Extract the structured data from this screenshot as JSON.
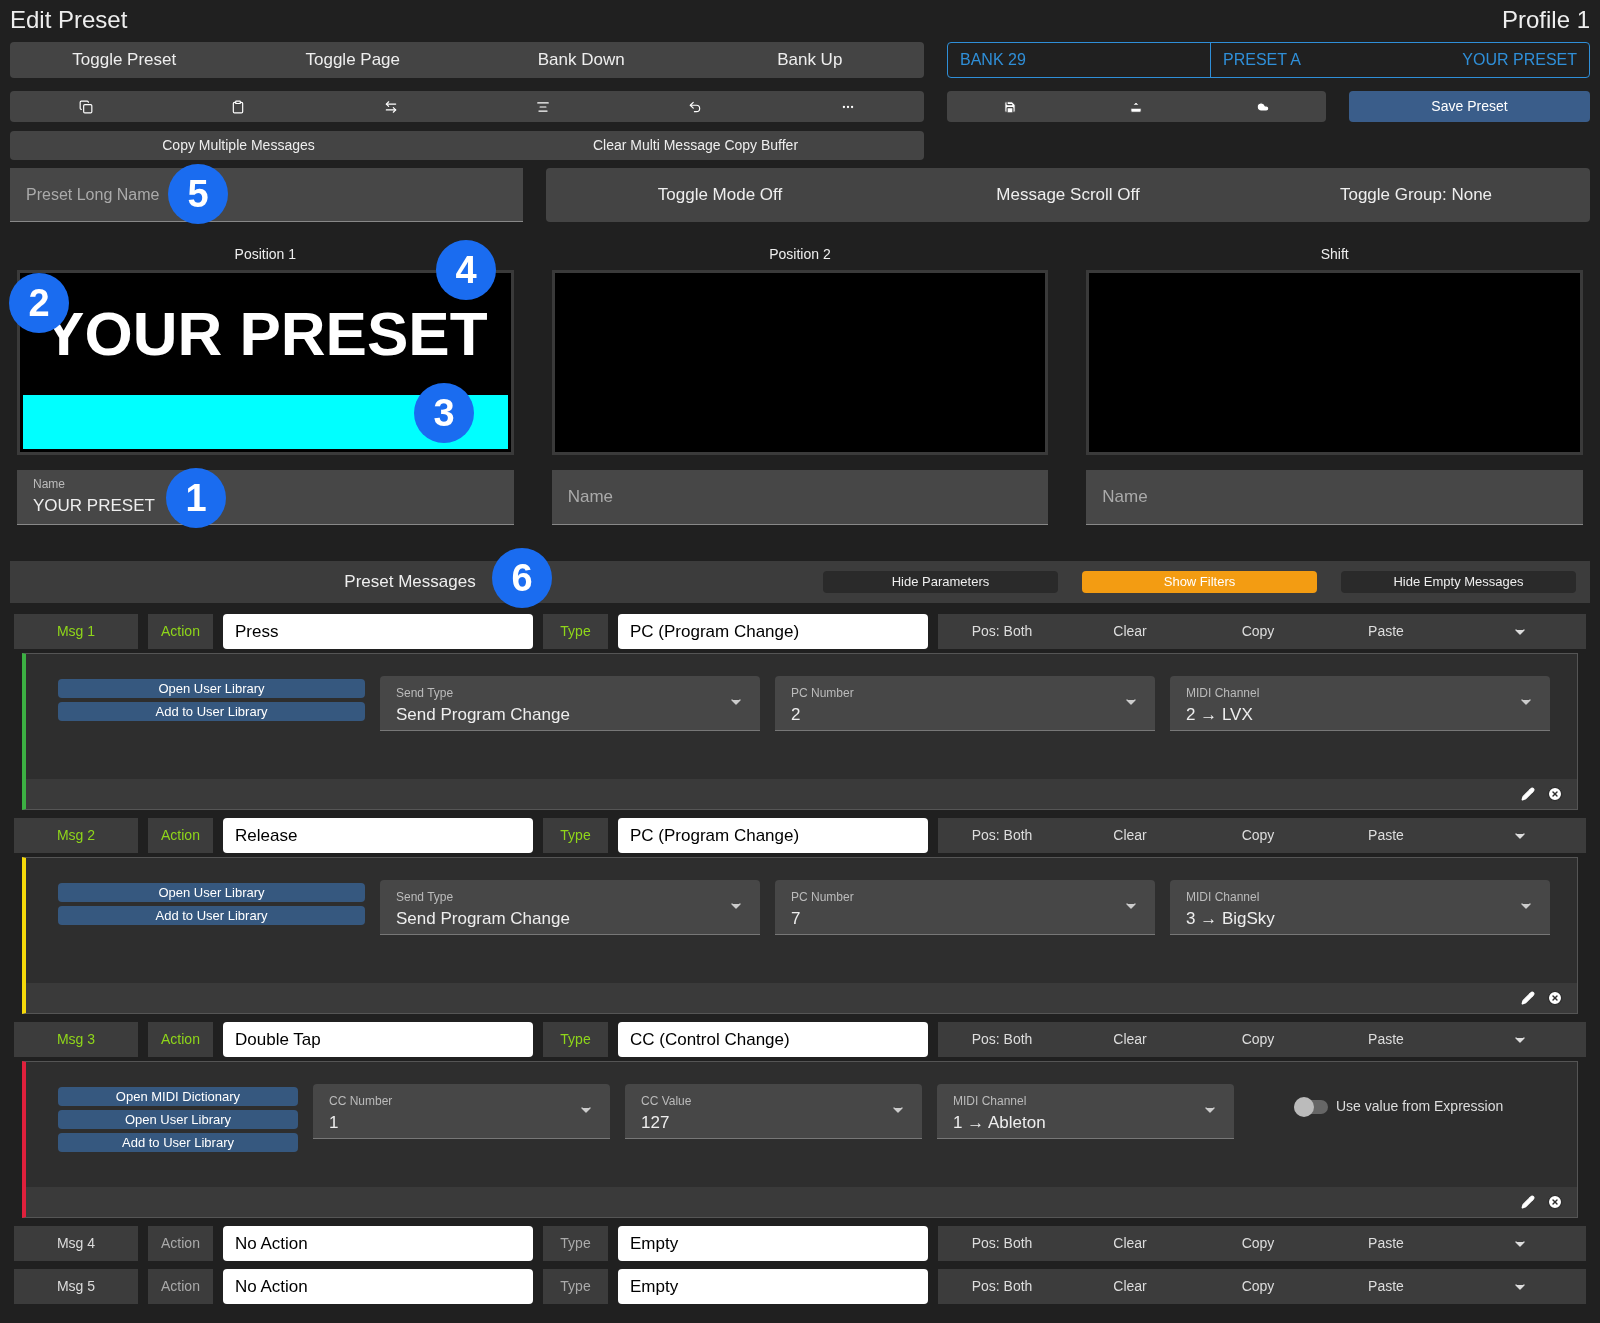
{
  "title": "Edit Preset",
  "profile": "Profile 1",
  "top_buttons": [
    "Toggle Preset",
    "Toggle Page",
    "Bank Down",
    "Bank Up"
  ],
  "bank_display": {
    "bank": "BANK 29",
    "preset": "PRESET A",
    "name": "YOUR PRESET"
  },
  "save_button": "Save Preset",
  "copy_buttons": [
    "Copy Multiple Messages",
    "Clear Multi Message Copy Buffer"
  ],
  "long_name": {
    "placeholder": "Preset Long Name"
  },
  "mode_buttons": [
    "Toggle Mode Off",
    "Message Scroll Off",
    "Toggle Group: None"
  ],
  "positions": [
    {
      "label": "Position 1",
      "screen_text": "YOUR PRESET",
      "color": "#00ffff",
      "name_label": "Name",
      "name_value": "YOUR PRESET"
    },
    {
      "label": "Position 2",
      "name_placeholder": "Name"
    },
    {
      "label": "Shift",
      "name_placeholder": "Name"
    }
  ],
  "messages_header": {
    "title": "Preset Messages",
    "filters": [
      {
        "label": "Hide Parameters",
        "selected": false
      },
      {
        "label": "Show Filters",
        "selected": true
      },
      {
        "label": "Hide Empty Messages",
        "selected": false
      }
    ]
  },
  "messages": [
    {
      "label": "Msg 1",
      "active": true,
      "action_label": "Action",
      "action": "Press",
      "type_label": "Type",
      "type": "PC (Program Change)",
      "pos": "Pos: Both",
      "tools": [
        "Clear",
        "Copy",
        "Paste"
      ],
      "expanded": true,
      "color": "#3cb043",
      "buttons": [
        "Open User Library",
        "Add to User Library"
      ],
      "selects": [
        {
          "label": "Send Type",
          "value": "Send Program Change"
        },
        {
          "label": "PC Number",
          "value": "2"
        },
        {
          "label": "MIDI Channel",
          "value": "2 → LVX"
        }
      ]
    },
    {
      "label": "Msg 2",
      "active": true,
      "action_label": "Action",
      "action": "Release",
      "type_label": "Type",
      "type": "PC (Program Change)",
      "pos": "Pos: Both",
      "tools": [
        "Clear",
        "Copy",
        "Paste"
      ],
      "expanded": true,
      "color": "#f5d90a",
      "buttons": [
        "Open User Library",
        "Add to User Library"
      ],
      "selects": [
        {
          "label": "Send Type",
          "value": "Send Program Change"
        },
        {
          "label": "PC Number",
          "value": "7"
        },
        {
          "label": "MIDI Channel",
          "value": "3 → BigSky"
        }
      ]
    },
    {
      "label": "Msg 3",
      "active": true,
      "action_label": "Action",
      "action": "Double Tap",
      "type_label": "Type",
      "type": "CC (Control Change)",
      "pos": "Pos: Both",
      "tools": [
        "Clear",
        "Copy",
        "Paste"
      ],
      "expanded": true,
      "color": "#e0203c",
      "buttons": [
        "Open MIDI Dictionary",
        "Open User Library",
        "Add to User Library"
      ],
      "selects": [
        {
          "label": "CC Number",
          "value": "1"
        },
        {
          "label": "CC Value",
          "value": "127"
        },
        {
          "label": "MIDI Channel",
          "value": "1 → Ableton"
        }
      ],
      "toggle": {
        "label": "Use value from Expression",
        "on": false
      }
    },
    {
      "label": "Msg 4",
      "active": false,
      "action_label": "Action",
      "action": "No Action",
      "type_label": "Type",
      "type": "Empty",
      "pos": "Pos: Both",
      "tools": [
        "Clear",
        "Copy",
        "Paste"
      ],
      "expanded": false
    },
    {
      "label": "Msg 5",
      "active": false,
      "action_label": "Action",
      "action": "No Action",
      "type_label": "Type",
      "type": "Empty",
      "pos": "Pos: Both",
      "tools": [
        "Clear",
        "Copy",
        "Paste"
      ],
      "expanded": false
    }
  ],
  "callouts": [
    "1",
    "2",
    "3",
    "4",
    "5",
    "6"
  ]
}
